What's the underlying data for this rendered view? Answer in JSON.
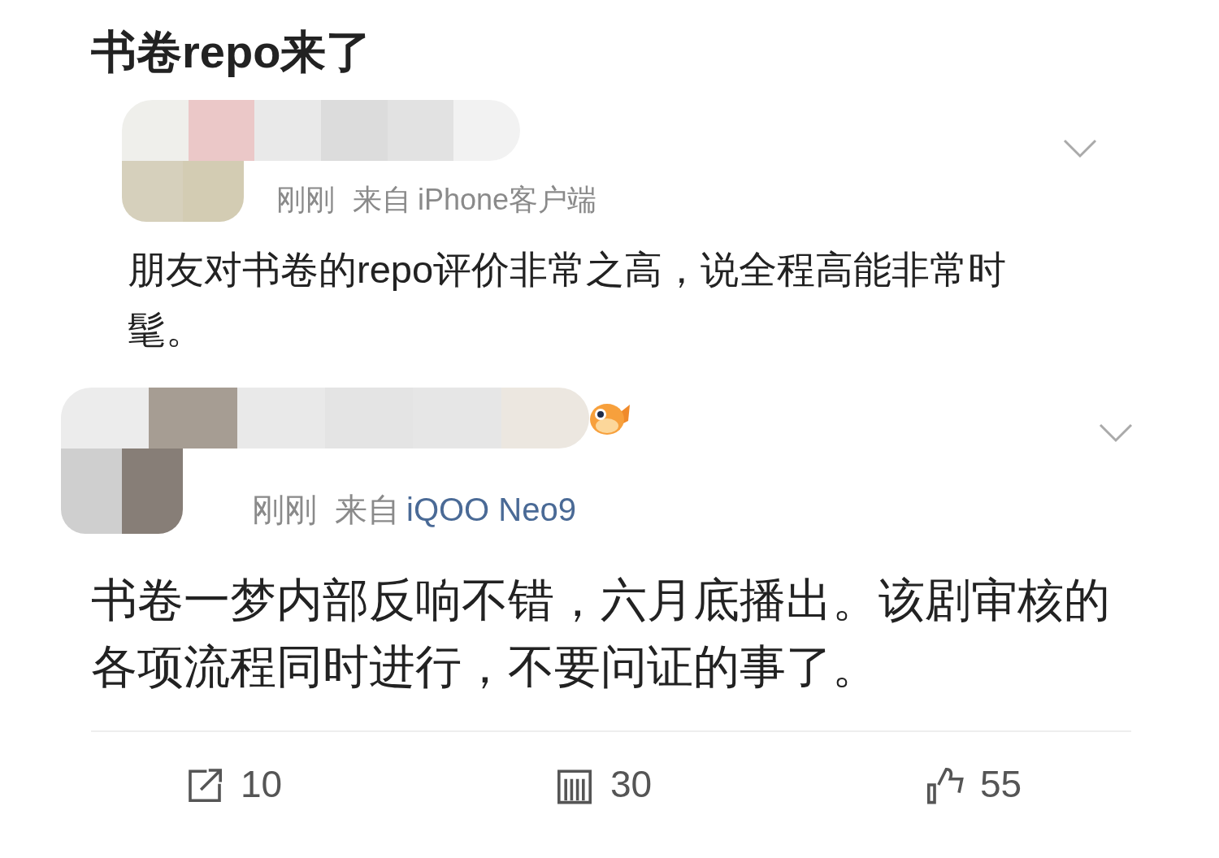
{
  "title": "书卷repo来了",
  "posts": [
    {
      "time": "刚刚",
      "via": "来自",
      "source": "iPhone客户端",
      "source_linked": false,
      "body": "朋友对书卷的repo评价非常之高，说全程高能非常时髦。"
    },
    {
      "time": "刚刚",
      "via": "来自",
      "source": "iQOO Neo9",
      "source_linked": true,
      "badge_icon": true,
      "body": "书卷一梦内部反响不错，六月底播出。该剧审核的各项流程同时进行，不要问证的事了。"
    }
  ],
  "actions": [
    {
      "kind": "repost",
      "count": "10"
    },
    {
      "kind": "comment",
      "count": "30"
    },
    {
      "kind": "like",
      "count": "55"
    }
  ]
}
